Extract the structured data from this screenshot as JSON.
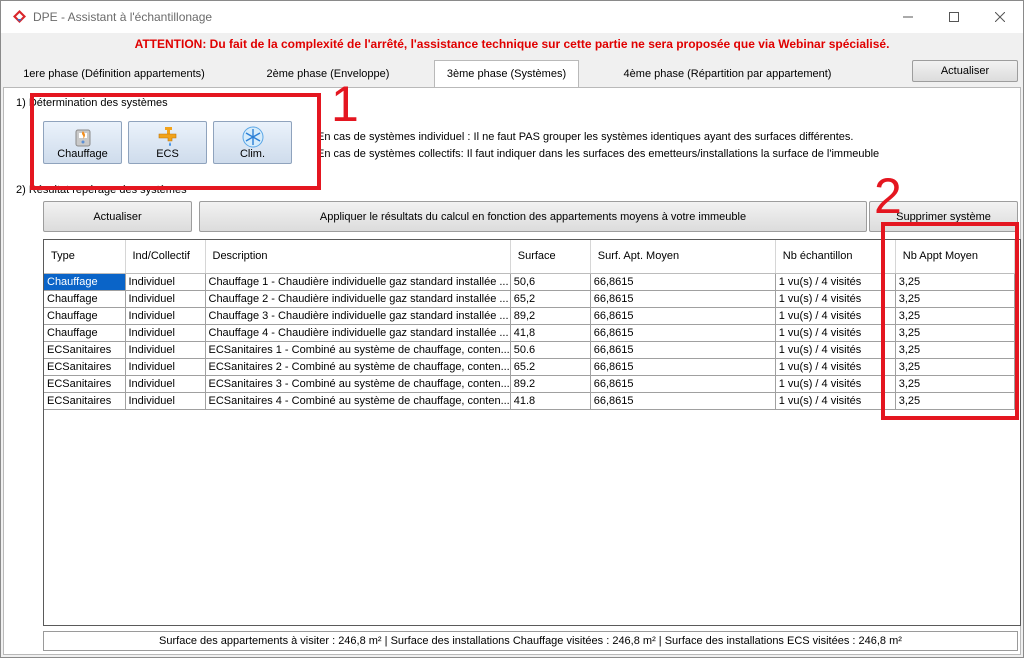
{
  "window": {
    "title": "DPE - Assistant à l'échantillonage",
    "minimize_icon": "minimize-icon",
    "maximize_icon": "maximize-icon",
    "close_icon": "close-icon"
  },
  "attention": "ATTENTION: Du fait de la complexité de l'arrêté, l'assistance technique sur cette partie ne sera proposée que via Webinar spécialisé.",
  "tabs": [
    {
      "label": "1ere phase (Définition appartements)",
      "active": false
    },
    {
      "label": "2ème phase (Enveloppe)",
      "active": false
    },
    {
      "label": "3ème phase (Systèmes)",
      "active": true
    },
    {
      "label": "4ème phase (Répartition par appartement)",
      "active": false
    }
  ],
  "top_actualiser": "Actualiser",
  "section1": {
    "title": "1) Détermination des systèmes",
    "buttons": [
      {
        "label": "Chauffage",
        "icon": "radiator-icon"
      },
      {
        "label": "ECS",
        "icon": "faucet-icon"
      },
      {
        "label": "Clim.",
        "icon": "snowflake-icon"
      }
    ],
    "info": [
      "En cas de systèmes individuel : Il ne faut PAS grouper les systèmes identiques ayant des surfaces différentes.",
      "En cas de systèmes collectifs: Il faut indiquer dans les surfaces des emetteurs/installations la surface de l'immeuble"
    ]
  },
  "section2": {
    "title": "2) Résultat repérage des systèmes",
    "actualiser": "Actualiser",
    "appliquer": "Appliquer le résultats du calcul en fonction des appartements moyens à votre immeuble",
    "supprimer": "Supprimer système"
  },
  "grid": {
    "columns": [
      "Type",
      "Ind/Collectif",
      "Description",
      "Surface",
      "Surf. Apt. Moyen",
      "Nb échantillon",
      "Nb Appt Moyen"
    ],
    "rows": [
      [
        "Chauffage",
        "Individuel",
        "Chauffage  1 - Chaudière individuelle gaz standard installée ...",
        "50,6",
        "66,8615",
        "1 vu(s) / 4 visités",
        "3,25"
      ],
      [
        "Chauffage",
        "Individuel",
        "Chauffage  2 - Chaudière individuelle gaz standard installée ...",
        "65,2",
        "66,8615",
        "1 vu(s) / 4 visités",
        "3,25"
      ],
      [
        "Chauffage",
        "Individuel",
        "Chauffage  3 - Chaudière individuelle gaz standard installée ...",
        "89,2",
        "66,8615",
        "1 vu(s) / 4 visités",
        "3,25"
      ],
      [
        "Chauffage",
        "Individuel",
        "Chauffage  4 - Chaudière individuelle gaz standard installée ...",
        "41,8",
        "66,8615",
        "1 vu(s) / 4 visités",
        "3,25"
      ],
      [
        "ECSanitaires",
        "Individuel",
        "ECSanitaires  1 - Combiné au système de chauffage, conten...",
        "50.6",
        "66,8615",
        "1 vu(s) / 4 visités",
        "3,25"
      ],
      [
        "ECSanitaires",
        "Individuel",
        "ECSanitaires  2 - Combiné au système de chauffage, conten...",
        "65.2",
        "66,8615",
        "1 vu(s) / 4 visités",
        "3,25"
      ],
      [
        "ECSanitaires",
        "Individuel",
        "ECSanitaires  3 - Combiné au système de chauffage, conten...",
        "89.2",
        "66,8615",
        "1 vu(s) / 4 visités",
        "3,25"
      ],
      [
        "ECSanitaires",
        "Individuel",
        "ECSanitaires  4 - Combiné au système de chauffage, conten...",
        "41.8",
        "66,8615",
        "1 vu(s) / 4 visités",
        "3,25"
      ]
    ]
  },
  "status": "Surface des appartements à visiter : 246,8 m²   |   Surface des installations Chauffage visitées : 246,8 m²   |   Surface des installations ECS visitées : 246,8 m²",
  "annotations": [
    "1",
    "2"
  ],
  "colors": {
    "attention": "#e00000",
    "selection": "#0a64c8",
    "annotation": "#e41620"
  }
}
